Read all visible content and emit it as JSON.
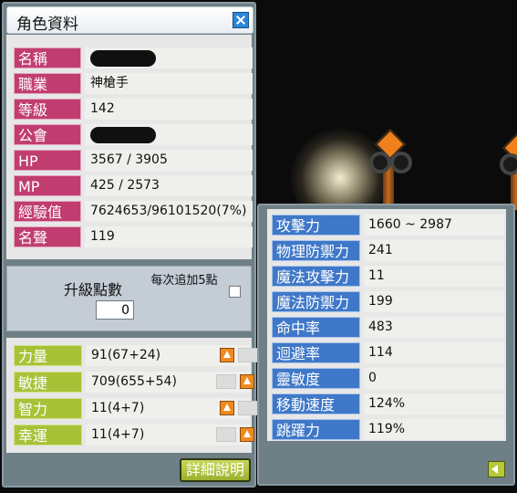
{
  "window_title": "角色資料",
  "info": [
    {
      "label": "名稱",
      "value": ""
    },
    {
      "label": "職業",
      "value": "神槍手"
    },
    {
      "label": "等級",
      "value": "142"
    },
    {
      "label": "公會",
      "value": ""
    },
    {
      "label": "HP",
      "value": "3567 / 3905"
    },
    {
      "label": "MP",
      "value": "425 / 2573"
    },
    {
      "label": "經驗值",
      "value": "7624653/96101520(7%)"
    },
    {
      "label": "名聲",
      "value": "119"
    }
  ],
  "ap": {
    "title": "升級點數",
    "value": "0",
    "note": "每次追加5點"
  },
  "stats": [
    {
      "label": "力量",
      "value": "91(67+24)"
    },
    {
      "label": "敏捷",
      "value": "709(655+54)"
    },
    {
      "label": "智力",
      "value": "11(4+7)"
    },
    {
      "label": "幸運",
      "value": "11(4+7)"
    }
  ],
  "detail_button": "詳細說明",
  "details": [
    {
      "label": "攻擊力",
      "value": "1660 ~ 2987"
    },
    {
      "label": "物理防禦力",
      "value": "241"
    },
    {
      "label": "魔法攻擊力",
      "value": "11"
    },
    {
      "label": "魔法防禦力",
      "value": "199"
    },
    {
      "label": "命中率",
      "value": "483"
    },
    {
      "label": "迴避率",
      "value": "114"
    },
    {
      "label": "靈敏度",
      "value": "0"
    },
    {
      "label": "移動速度",
      "value": "124%"
    },
    {
      "label": "跳躍力",
      "value": "119%"
    }
  ],
  "colors": {
    "info_label": "#c13d6f",
    "stat_label": "#a8c238",
    "detail_label": "#3f78c8",
    "window_frame": "#6f7f86"
  },
  "icons": {
    "close": "close-icon",
    "up": "arrow-up-icon",
    "back": "back-arrow-icon"
  }
}
